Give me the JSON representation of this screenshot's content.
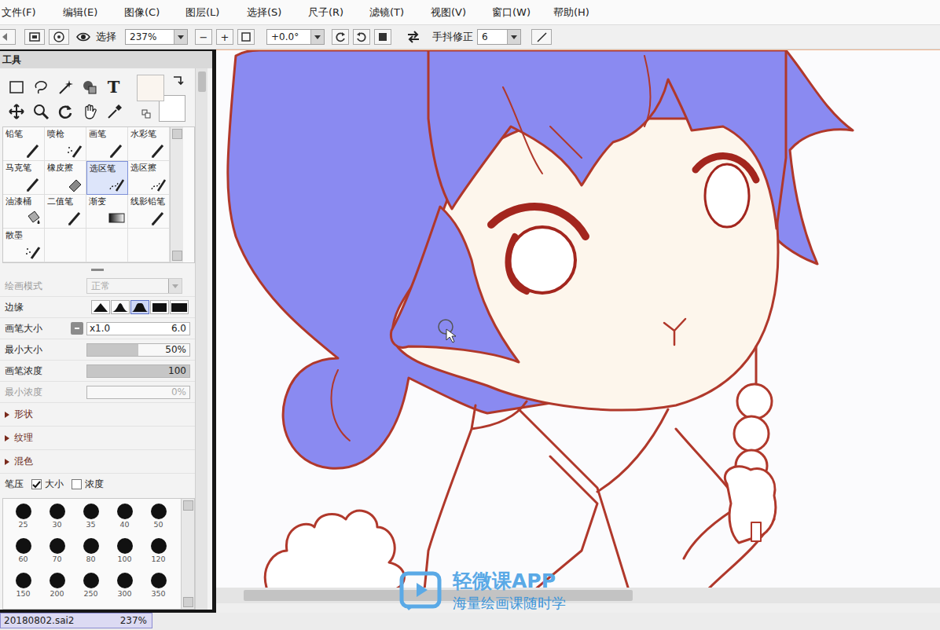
{
  "menu": [
    {
      "label": "文件(F)"
    },
    {
      "label": "编辑(E)"
    },
    {
      "label": "图像(C)"
    },
    {
      "label": "图层(L)"
    },
    {
      "label": "选择(S)"
    },
    {
      "label": "尺子(R)"
    },
    {
      "label": "滤镜(T)"
    },
    {
      "label": "视图(V)"
    },
    {
      "label": "窗口(W)"
    },
    {
      "label": "帮助(H)"
    }
  ],
  "toolbar": {
    "selection_label": "选择",
    "zoom": "237%",
    "zoom_out": "−",
    "zoom_in": "+",
    "rotation": "+0.0°",
    "stabilizer_label": "手抖修正",
    "stabilizer_value": "6"
  },
  "tool_panel": {
    "title": "工具",
    "text_tool": "T",
    "primary_color": "#faf5ef",
    "secondary_color": "#ffffff",
    "brushes": [
      {
        "label": "铅笔",
        "kind": "pen",
        "selected": false
      },
      {
        "label": "喷枪",
        "kind": "airbrush",
        "selected": false
      },
      {
        "label": "画笔",
        "kind": "pen",
        "selected": false
      },
      {
        "label": "水彩笔",
        "kind": "pen",
        "selected": false
      },
      {
        "label": "马克笔",
        "kind": "pen",
        "selected": false
      },
      {
        "label": "橡皮擦",
        "kind": "eraser",
        "selected": false
      },
      {
        "label": "选区笔",
        "kind": "selection",
        "selected": true
      },
      {
        "label": "选区擦",
        "kind": "selection",
        "selected": false
      },
      {
        "label": "油漆桶",
        "kind": "bucket",
        "selected": false
      },
      {
        "label": "二值笔",
        "kind": "pen",
        "selected": false
      },
      {
        "label": "渐变",
        "kind": "gradient",
        "selected": false
      },
      {
        "label": "线影铅笔",
        "kind": "pen",
        "selected": false
      },
      {
        "label": "散墨",
        "kind": "airbrush",
        "selected": false
      }
    ],
    "blend": {
      "label": "绘画模式",
      "value": "正常",
      "disabled": true
    },
    "edge": {
      "label": "边缘",
      "options": [
        {
          "kind": "peak",
          "selected": false
        },
        {
          "kind": "bell",
          "selected": false
        },
        {
          "kind": "flatbell",
          "selected": true
        },
        {
          "kind": "flat",
          "selected": false
        },
        {
          "kind": "square",
          "selected": false
        }
      ]
    },
    "params": [
      {
        "label": "画笔大小",
        "kind": "size",
        "multiplier": "x1.0",
        "value": "6.0",
        "disabled": false
      },
      {
        "label": "最小大小",
        "kind": "slider",
        "value": "50%",
        "level": 0.5,
        "disabled": false
      },
      {
        "label": "画笔浓度",
        "kind": "slider",
        "value": "100",
        "level": 1,
        "disabled": false
      },
      {
        "label": "最小浓度",
        "kind": "slider",
        "value": "0%",
        "level": 0,
        "disabled": true
      }
    ],
    "sections": [
      {
        "label": "形状",
        "expanded": false
      },
      {
        "label": "纹理",
        "expanded": false
      },
      {
        "label": "混色",
        "expanded": false
      }
    ],
    "pressure": {
      "label": "笔压",
      "options": [
        {
          "label": "大小",
          "checked": true
        },
        {
          "label": "浓度",
          "checked": false
        }
      ]
    },
    "brush_sizes": [
      "25",
      "30",
      "35",
      "40",
      "50",
      "60",
      "70",
      "80",
      "100",
      "120",
      "150",
      "200",
      "250",
      "300",
      "350"
    ]
  },
  "document_tab": {
    "name": "20180802.sai2",
    "zoom": "237%"
  },
  "watermark": {
    "title": "轻微课APP",
    "subtitle": "海量绘画课随时学"
  }
}
